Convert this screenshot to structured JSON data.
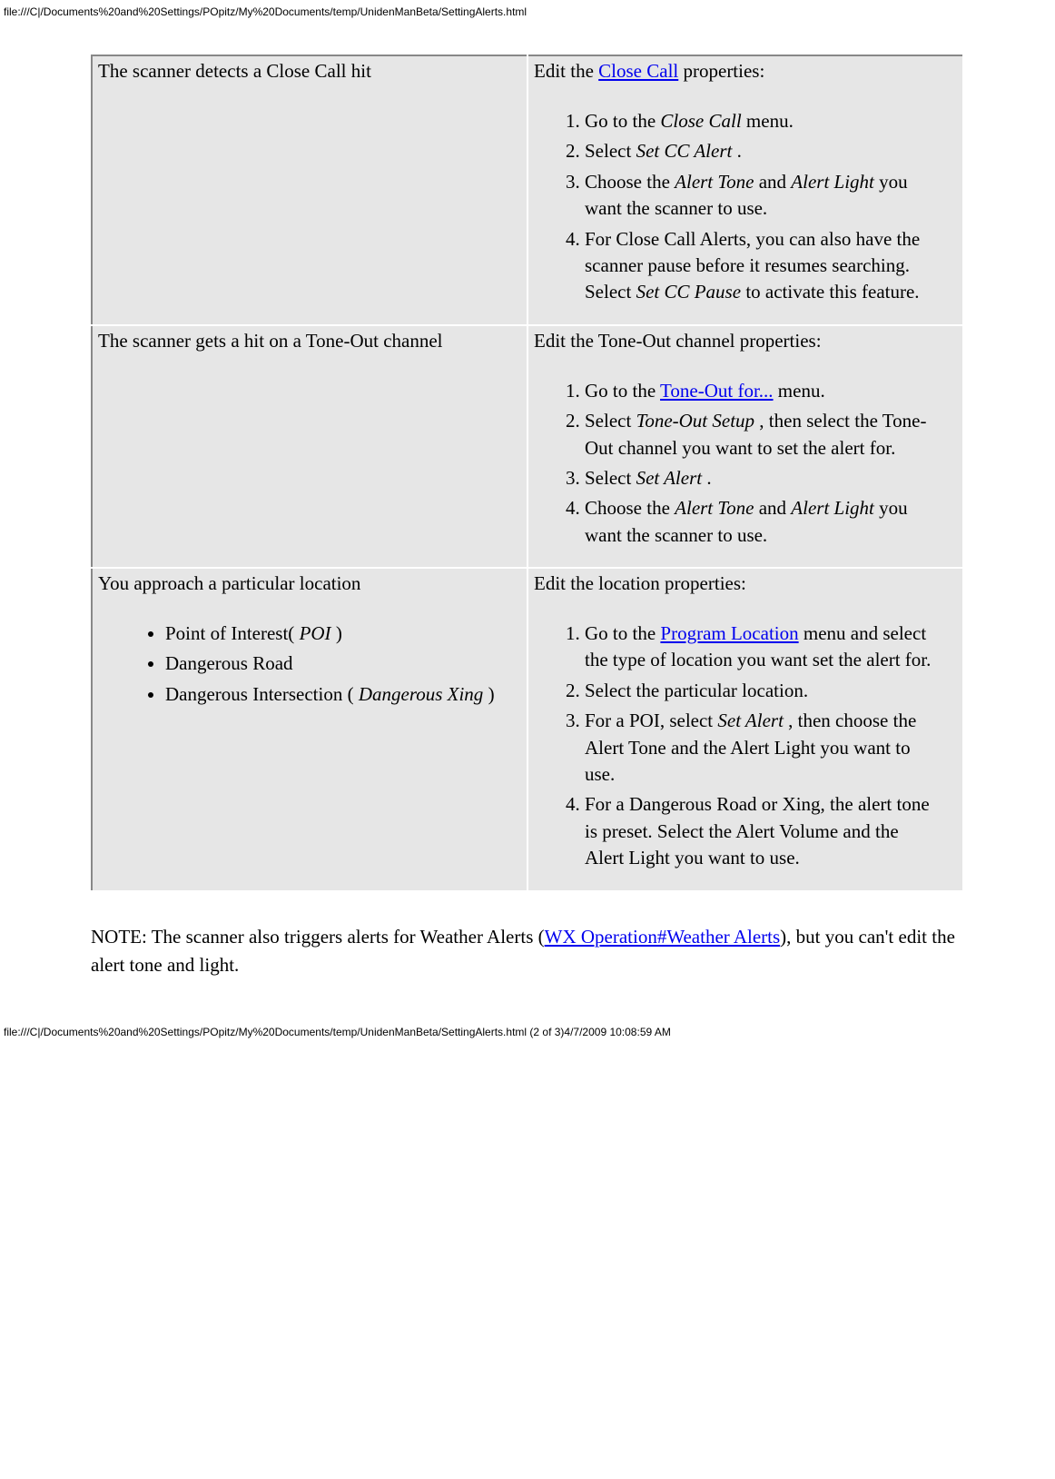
{
  "header_path": "file:///C|/Documents%20and%20Settings/POpitz/My%20Documents/temp/UnidenManBeta/SettingAlerts.html",
  "footer_path": "file:///C|/Documents%20and%20Settings/POpitz/My%20Documents/temp/UnidenManBeta/SettingAlerts.html (2 of 3)4/7/2009 10:08:59 AM",
  "rows": [
    {
      "left": {
        "text": "The scanner detects a Close Call hit"
      },
      "right": {
        "intro_pre": "Edit the ",
        "intro_link": "Close Call",
        "intro_post": " properties:",
        "step1_pre": "Go to the ",
        "step1_it": "Close Call",
        "step1_post": " menu.",
        "step2_pre": "Select ",
        "step2_it": "Set CC Alert ",
        "step2_post": ".",
        "step3_pre": "Choose the ",
        "step3_it1": "Alert Tone",
        "step3_mid": " and ",
        "step3_it2": "Alert Light",
        "step3_post": " you want the scanner to use.",
        "step4_pre": "For Close Call Alerts, you can also have the scanner pause before it resumes searching. Select ",
        "step4_it": "Set CC Pause",
        "step4_post": " to activate this feature."
      }
    },
    {
      "left": {
        "text": "The scanner gets a hit on a Tone-Out channel"
      },
      "right": {
        "intro": "Edit the Tone-Out channel properties:",
        "step1_pre": "Go to the ",
        "step1_link": "Tone-Out for...",
        "step1_post": " menu.",
        "step2_pre": "Select ",
        "step2_it": "Tone-Out Setup ",
        "step2_post": ", then select the Tone-Out channel you want to set the alert for.",
        "step3_pre": "Select ",
        "step3_it": "Set Alert ",
        "step3_post": ".",
        "step4_pre": "Choose the ",
        "step4_it1": "Alert Tone",
        "step4_mid": " and ",
        "step4_it2": "Alert Light",
        "step4_post": " you want the scanner to use."
      }
    },
    {
      "left": {
        "text": "You approach a particular location",
        "b1_pre": "Point of Interest( ",
        "b1_it": "POI",
        "b1_post": " )",
        "b2": "Dangerous Road",
        "b3_pre": "Dangerous Intersection ( ",
        "b3_it": "Dangerous Xing",
        "b3_post": " )"
      },
      "right": {
        "intro": "Edit the location properties:",
        "step1_pre": "Go to the ",
        "step1_link": "Program Location",
        "step1_post": " menu and select the type of location you want set the alert for.",
        "step2": "Select the particular location.",
        "step3_pre": "For a POI, select ",
        "step3_it": "Set Alert ",
        "step3_post": ", then choose the Alert Tone and the Alert Light you want to use.",
        "step4": "For a Dangerous Road or Xing, the alert tone is preset. Select the Alert Volume and the Alert Light you want to use."
      }
    }
  ],
  "note": {
    "pre": "NOTE: The scanner also triggers alerts for Weather Alerts (",
    "link": "WX Operation#Weather Alerts",
    "post": "), but you can't edit the alert tone and light."
  }
}
